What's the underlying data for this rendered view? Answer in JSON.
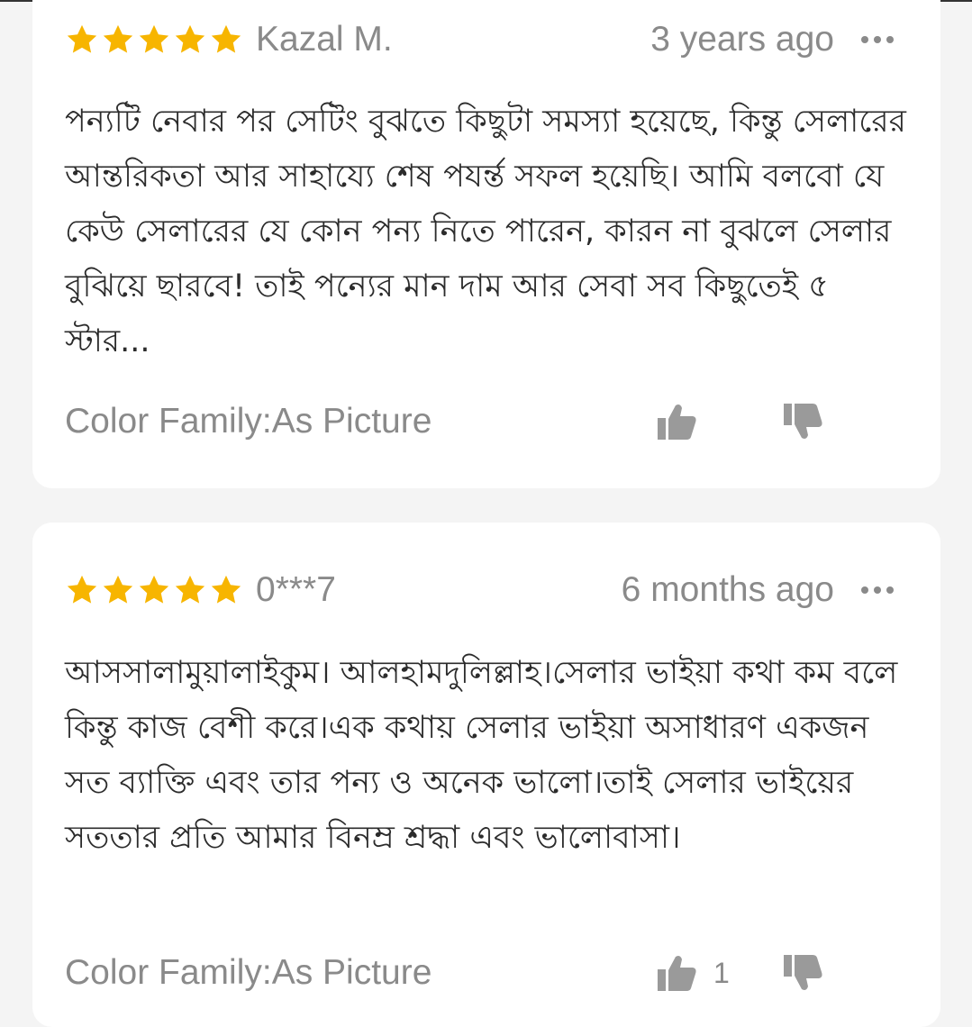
{
  "reviews": [
    {
      "rating": 5,
      "reviewer": "Kazal M.",
      "time": "3 years ago",
      "text": "পন্যটি নেবার পর সেটিং বুঝতে কিছুটা সমস্যা হয়েছে, কিন্তু সেলারের আন্তরিকতা আর সাহায্যে শেষ পযর্ন্ত সফল হয়েছি। আমি বলবো যে কেউ সেলারের যে কোন পন্য নিতে পারেন, কারন না বুঝলে সেলার বুঝিয়ে ছারবে! তাই পন্যের মান দাম আর সেবা সব কিছুতেই ৫ স্টার...",
      "variant": "Color Family:As Picture",
      "likes": ""
    },
    {
      "rating": 5,
      "reviewer": "0***7",
      "time": "6 months ago",
      "text": "আসসালামুয়ালাইকুম। আলহামদুলিল্লাহ।সেলার ভাইয়া কথা কম বলে কিন্তু কাজ বেশী করে।এক কথায় সেলার ভাইয়া অসাধারণ একজন সত ব্যাক্তি এবং তার পন্য ও অনেক ভালো।তাই সেলার ভাইয়ের সততার প্রতি আমার বিনম্র শ্রদ্ধা এবং ভালোবাসা।",
      "variant": "Color Family:As Picture",
      "likes": "1"
    }
  ],
  "colors": {
    "star": "#F7B500",
    "muted": "#8a8a8a",
    "text": "#2b2b2b",
    "card": "#ffffff",
    "background": "#f4f4f4"
  },
  "icons": {
    "rating": "star-icon",
    "more": "more-options-icon",
    "like": "thumbs-up-icon",
    "dislike": "thumbs-down-icon"
  }
}
